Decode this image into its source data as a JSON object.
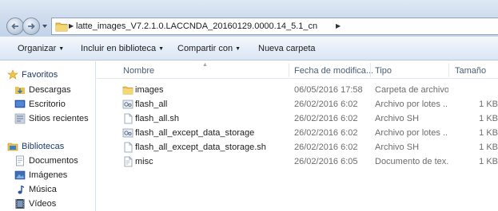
{
  "address_bar": {
    "path": "latte_images_V7.2.1.0.LACCNDA_20160129.0000.14_5.1_cn"
  },
  "toolbar": {
    "organize": "Organizar",
    "include_library": "Incluir en biblioteca",
    "share": "Compartir con",
    "new_folder": "Nueva carpeta"
  },
  "sidebar": {
    "favorites": {
      "label": "Favoritos",
      "items": [
        "Descargas",
        "Escritorio",
        "Sitios recientes"
      ]
    },
    "libraries": {
      "label": "Bibliotecas",
      "items": [
        "Documentos",
        "Imágenes",
        "Música",
        "Vídeos"
      ]
    }
  },
  "columns": {
    "name": "Nombre",
    "date": "Fecha de modifica...",
    "type": "Tipo",
    "size": "Tamaño"
  },
  "files": [
    {
      "name": "images",
      "date": "06/05/2016 17:58",
      "type": "Carpeta de archivos",
      "size": "",
      "icon": "folder-icon"
    },
    {
      "name": "flash_all",
      "date": "26/02/2016 6:02",
      "type": "Archivo por lotes ...",
      "size": "1 KB",
      "icon": "batch-file-icon"
    },
    {
      "name": "flash_all.sh",
      "date": "26/02/2016 6:02",
      "type": "Archivo SH",
      "size": "1 KB",
      "icon": "file-icon"
    },
    {
      "name": "flash_all_except_data_storage",
      "date": "26/02/2016 6:02",
      "type": "Archivo por lotes ...",
      "size": "1 KB",
      "icon": "batch-file-icon"
    },
    {
      "name": "flash_all_except_data_storage.sh",
      "date": "26/02/2016 6:02",
      "type": "Archivo SH",
      "size": "1 KB",
      "icon": "file-icon"
    },
    {
      "name": "misc",
      "date": "26/02/2016 6:05",
      "type": "Documento de tex...",
      "size": "1 KB",
      "icon": "text-file-icon"
    }
  ],
  "colors": {
    "address_bar_bg": "#cfdced",
    "toolbar_bg": "#e6eef8",
    "folder_yellow": "#e8c24f",
    "secondary_text": "#6d6d6d"
  }
}
